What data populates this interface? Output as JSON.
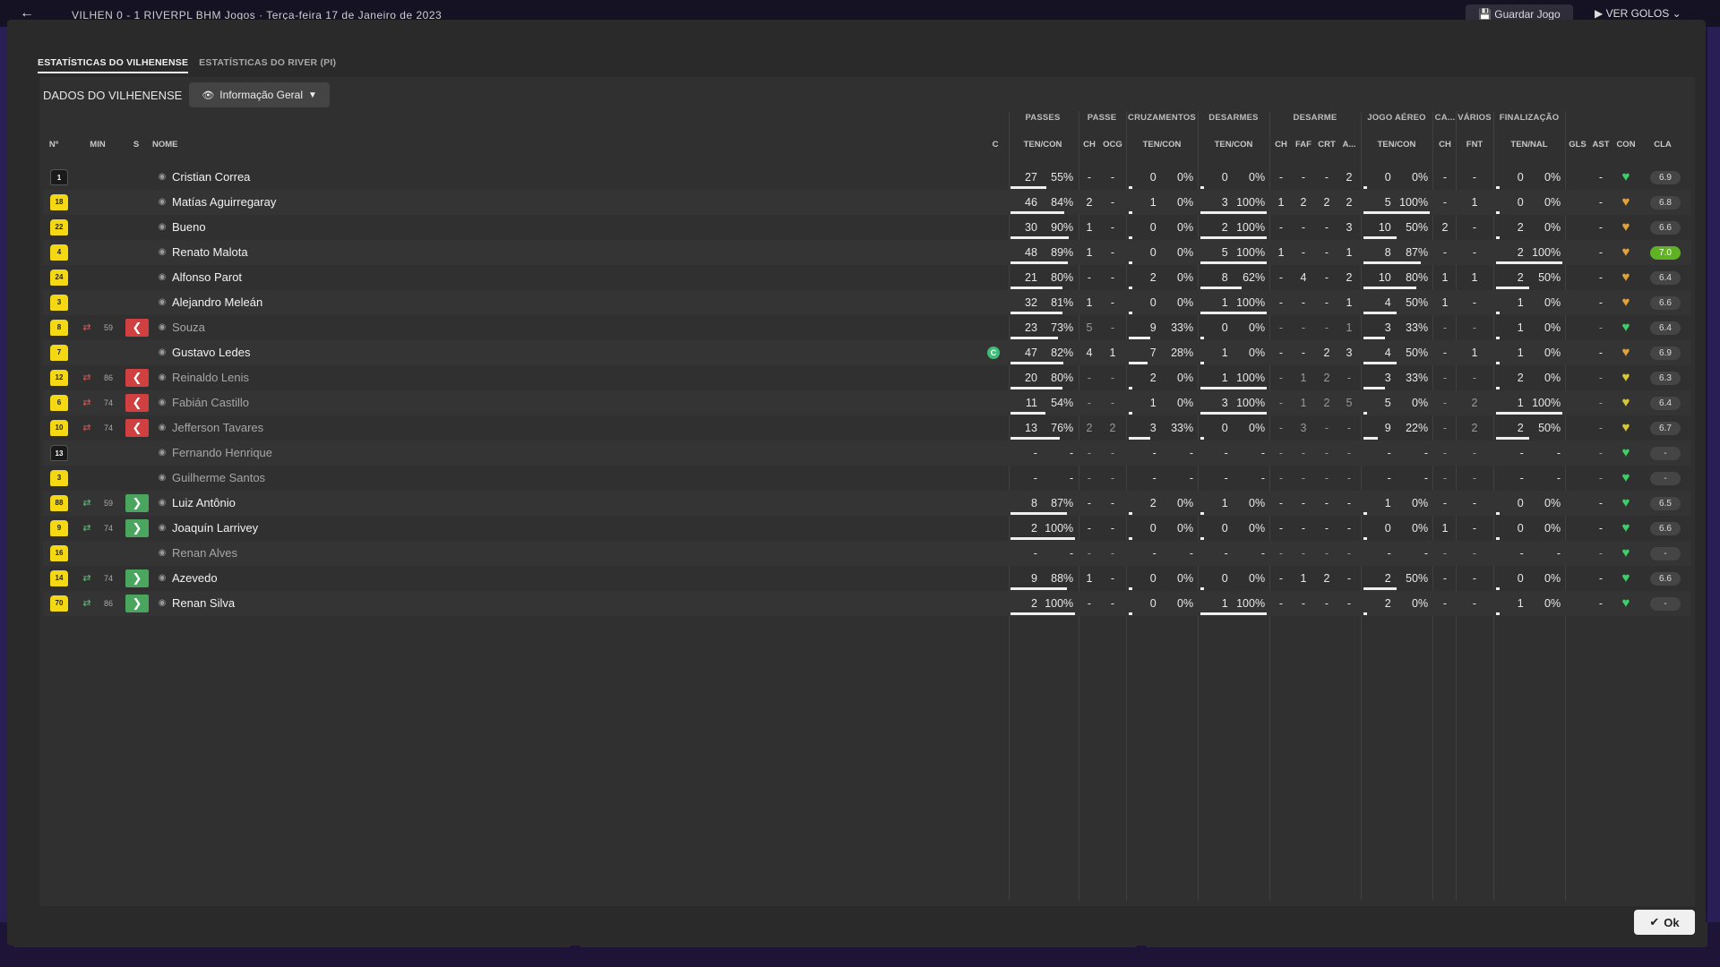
{
  "background": {
    "score_text": "VILHEN  0 - 1  RIVERPL  BHM  Jogos  ·  Terça-feira 17 de Janeiro de 2023",
    "save_label": "Guardar Jogo",
    "goals_label": "VER GOLOS"
  },
  "tabs": [
    {
      "label": "ESTATÍSTICAS DO VILHENENSE",
      "active": true
    },
    {
      "label": "ESTATÍSTICAS DO RIVER (PI)",
      "active": false
    }
  ],
  "panel": {
    "title": "DADOS DO VILHENENSE",
    "view_select": "Informação Geral"
  },
  "groups": [
    "PASSES",
    "PASSE",
    "CRUZAMENTOS",
    "DESARMES",
    "DESARME",
    "JOGO AÉREO",
    "CA...",
    "VÁRIOS",
    "FINALIZAÇÃO"
  ],
  "columns": {
    "no": "Nº",
    "min": "MIN",
    "s": "S",
    "name": "NOME",
    "c": "C",
    "passes": "TEN/CON",
    "pch": "CH",
    "pocg": "OCG",
    "cross": "TEN/CON",
    "tackles": "TEN/CON",
    "dch": "CH",
    "dfaf": "FAF",
    "dcrt": "CRT",
    "da": "A...",
    "aerial": "TEN/CON",
    "cach": "CH",
    "fnt": "FNT",
    "shots": "TEN/NAL",
    "gls": "GLS",
    "ast": "AST",
    "con": "CON",
    "cla": "CLA"
  },
  "players": [
    {
      "no": "1",
      "gk": true,
      "min": "",
      "sub": "",
      "name": "Cristian Correa",
      "dim": false,
      "cap": false,
      "p": [
        "27",
        "55%"
      ],
      "pch": "-",
      "pocg": "-",
      "cr": [
        "0",
        "0%"
      ],
      "ta": [
        "0",
        "0%"
      ],
      "dch": "-",
      "dfaf": "-",
      "dcrt": "-",
      "da": "2",
      "ae": [
        "0",
        "0%"
      ],
      "cach": "-",
      "fnt": "-",
      "sh": [
        "0",
        "0%"
      ],
      "gls": "",
      "ast": "-",
      "heart": "green",
      "rating": "6.9",
      "best": false
    },
    {
      "no": "18",
      "gk": false,
      "min": "",
      "sub": "",
      "name": "Matías Aguirregaray",
      "dim": false,
      "cap": false,
      "p": [
        "46",
        "84%"
      ],
      "pch": "2",
      "pocg": "-",
      "cr": [
        "1",
        "0%"
      ],
      "ta": [
        "3",
        "100%"
      ],
      "dch": "1",
      "dfaf": "2",
      "dcrt": "2",
      "da": "2",
      "ae": [
        "5",
        "100%"
      ],
      "cach": "-",
      "fnt": "1",
      "sh": [
        "0",
        "0%"
      ],
      "gls": "",
      "ast": "-",
      "heart": "orange",
      "rating": "6.8",
      "best": false
    },
    {
      "no": "22",
      "gk": false,
      "min": "",
      "sub": "",
      "name": "Bueno",
      "dim": false,
      "cap": false,
      "p": [
        "30",
        "90%"
      ],
      "pch": "1",
      "pocg": "-",
      "cr": [
        "0",
        "0%"
      ],
      "ta": [
        "2",
        "100%"
      ],
      "dch": "-",
      "dfaf": "-",
      "dcrt": "-",
      "da": "3",
      "ae": [
        "10",
        "50%"
      ],
      "cach": "2",
      "fnt": "-",
      "sh": [
        "2",
        "0%"
      ],
      "gls": "",
      "ast": "-",
      "heart": "orange",
      "rating": "6.6",
      "best": false
    },
    {
      "no": "4",
      "gk": false,
      "min": "",
      "sub": "",
      "name": "Renato Malota",
      "dim": false,
      "cap": false,
      "p": [
        "48",
        "89%"
      ],
      "pch": "1",
      "pocg": "-",
      "cr": [
        "0",
        "0%"
      ],
      "ta": [
        "5",
        "100%"
      ],
      "dch": "1",
      "dfaf": "-",
      "dcrt": "-",
      "da": "1",
      "ae": [
        "8",
        "87%"
      ],
      "cach": "-",
      "fnt": "-",
      "sh": [
        "2",
        "100%"
      ],
      "gls": "",
      "ast": "-",
      "heart": "orange",
      "rating": "7.0",
      "best": true
    },
    {
      "no": "24",
      "gk": false,
      "min": "",
      "sub": "",
      "name": "Alfonso Parot",
      "dim": false,
      "cap": false,
      "p": [
        "21",
        "80%"
      ],
      "pch": "-",
      "pocg": "-",
      "cr": [
        "2",
        "0%"
      ],
      "ta": [
        "8",
        "62%"
      ],
      "dch": "-",
      "dfaf": "4",
      "dcrt": "-",
      "da": "2",
      "ae": [
        "10",
        "80%"
      ],
      "cach": "1",
      "fnt": "1",
      "sh": [
        "2",
        "50%"
      ],
      "gls": "",
      "ast": "-",
      "heart": "orange",
      "rating": "6.4",
      "best": false
    },
    {
      "no": "3",
      "gk": false,
      "min": "",
      "sub": "",
      "name": "Alejandro Meleán",
      "dim": false,
      "cap": false,
      "p": [
        "32",
        "81%"
      ],
      "pch": "1",
      "pocg": "-",
      "cr": [
        "0",
        "0%"
      ],
      "ta": [
        "1",
        "100%"
      ],
      "dch": "-",
      "dfaf": "-",
      "dcrt": "-",
      "da": "1",
      "ae": [
        "4",
        "50%"
      ],
      "cach": "1",
      "fnt": "-",
      "sh": [
        "1",
        "0%"
      ],
      "gls": "",
      "ast": "-",
      "heart": "orange",
      "rating": "6.6",
      "best": false
    },
    {
      "no": "8",
      "gk": false,
      "min": "59",
      "sub": "out",
      "name": "Souza",
      "dim": true,
      "cap": false,
      "p": [
        "23",
        "73%"
      ],
      "pch": "5",
      "pocg": "-",
      "cr": [
        "9",
        "33%"
      ],
      "ta": [
        "0",
        "0%"
      ],
      "dch": "-",
      "dfaf": "-",
      "dcrt": "-",
      "da": "1",
      "ae": [
        "3",
        "33%"
      ],
      "cach": "-",
      "fnt": "-",
      "sh": [
        "1",
        "0%"
      ],
      "gls": "",
      "ast": "-",
      "heart": "green",
      "rating": "6.4",
      "best": false
    },
    {
      "no": "7",
      "gk": false,
      "min": "",
      "sub": "",
      "name": "Gustavo Ledes",
      "dim": false,
      "cap": true,
      "p": [
        "47",
        "82%"
      ],
      "pch": "4",
      "pocg": "1",
      "cr": [
        "7",
        "28%"
      ],
      "ta": [
        "1",
        "0%"
      ],
      "dch": "-",
      "dfaf": "-",
      "dcrt": "2",
      "da": "3",
      "ae": [
        "4",
        "50%"
      ],
      "cach": "-",
      "fnt": "1",
      "sh": [
        "1",
        "0%"
      ],
      "gls": "",
      "ast": "-",
      "heart": "orange",
      "rating": "6.9",
      "best": false
    },
    {
      "no": "12",
      "gk": false,
      "min": "86",
      "sub": "out",
      "name": "Reinaldo Lenis",
      "dim": true,
      "cap": false,
      "p": [
        "20",
        "80%"
      ],
      "pch": "-",
      "pocg": "-",
      "cr": [
        "2",
        "0%"
      ],
      "ta": [
        "1",
        "100%"
      ],
      "dch": "-",
      "dfaf": "1",
      "dcrt": "2",
      "da": "-",
      "ae": [
        "3",
        "33%"
      ],
      "cach": "-",
      "fnt": "-",
      "sh": [
        "2",
        "0%"
      ],
      "gls": "",
      "ast": "-",
      "heart": "yellow",
      "rating": "6.3",
      "best": false
    },
    {
      "no": "6",
      "gk": false,
      "min": "74",
      "sub": "out",
      "name": "Fabián Castillo",
      "dim": true,
      "cap": false,
      "p": [
        "11",
        "54%"
      ],
      "pch": "-",
      "pocg": "-",
      "cr": [
        "1",
        "0%"
      ],
      "ta": [
        "3",
        "100%"
      ],
      "dch": "-",
      "dfaf": "1",
      "dcrt": "2",
      "da": "5",
      "ae": [
        "5",
        "0%"
      ],
      "cach": "-",
      "fnt": "2",
      "sh": [
        "1",
        "100%"
      ],
      "gls": "",
      "ast": "-",
      "heart": "yellow",
      "rating": "6.4",
      "best": false
    },
    {
      "no": "10",
      "gk": false,
      "min": "74",
      "sub": "out",
      "name": "Jefferson Tavares",
      "dim": true,
      "cap": false,
      "p": [
        "13",
        "76%"
      ],
      "pch": "2",
      "pocg": "2",
      "cr": [
        "3",
        "33%"
      ],
      "ta": [
        "0",
        "0%"
      ],
      "dch": "-",
      "dfaf": "3",
      "dcrt": "-",
      "da": "-",
      "ae": [
        "9",
        "22%"
      ],
      "cach": "-",
      "fnt": "2",
      "sh": [
        "2",
        "50%"
      ],
      "gls": "",
      "ast": "-",
      "heart": "yellow",
      "rating": "6.7",
      "best": false
    },
    {
      "no": "13",
      "gk": true,
      "min": "",
      "sub": "",
      "name": "Fernando Henrique",
      "dim": true,
      "cap": false,
      "p": [
        "-",
        "-"
      ],
      "pch": "-",
      "pocg": "-",
      "cr": [
        "-",
        "-"
      ],
      "ta": [
        "-",
        "-"
      ],
      "dch": "-",
      "dfaf": "-",
      "dcrt": "-",
      "da": "-",
      "ae": [
        "-",
        "-"
      ],
      "cach": "-",
      "fnt": "-",
      "sh": [
        "-",
        "-"
      ],
      "gls": "",
      "ast": "-",
      "heart": "green",
      "rating": "-",
      "best": false
    },
    {
      "no": "3",
      "gk": false,
      "min": "",
      "sub": "",
      "name": "Guilherme Santos",
      "dim": true,
      "cap": false,
      "p": [
        "-",
        "-"
      ],
      "pch": "-",
      "pocg": "-",
      "cr": [
        "-",
        "-"
      ],
      "ta": [
        "-",
        "-"
      ],
      "dch": "-",
      "dfaf": "-",
      "dcrt": "-",
      "da": "-",
      "ae": [
        "-",
        "-"
      ],
      "cach": "-",
      "fnt": "-",
      "sh": [
        "-",
        "-"
      ],
      "gls": "",
      "ast": "-",
      "heart": "green",
      "rating": "-",
      "best": false
    },
    {
      "no": "88",
      "gk": false,
      "min": "59",
      "sub": "in",
      "name": "Luiz Antônio",
      "dim": false,
      "cap": false,
      "p": [
        "8",
        "87%"
      ],
      "pch": "-",
      "pocg": "-",
      "cr": [
        "2",
        "0%"
      ],
      "ta": [
        "1",
        "0%"
      ],
      "dch": "-",
      "dfaf": "-",
      "dcrt": "-",
      "da": "-",
      "ae": [
        "1",
        "0%"
      ],
      "cach": "-",
      "fnt": "-",
      "sh": [
        "0",
        "0%"
      ],
      "gls": "",
      "ast": "-",
      "heart": "green",
      "rating": "6.5",
      "best": false
    },
    {
      "no": "9",
      "gk": false,
      "min": "74",
      "sub": "in",
      "name": "Joaquín Larrivey",
      "dim": false,
      "cap": false,
      "p": [
        "2",
        "100%"
      ],
      "pch": "-",
      "pocg": "-",
      "cr": [
        "0",
        "0%"
      ],
      "ta": [
        "0",
        "0%"
      ],
      "dch": "-",
      "dfaf": "-",
      "dcrt": "-",
      "da": "-",
      "ae": [
        "0",
        "0%"
      ],
      "cach": "1",
      "fnt": "-",
      "sh": [
        "0",
        "0%"
      ],
      "gls": "",
      "ast": "-",
      "heart": "green",
      "rating": "6.6",
      "best": false
    },
    {
      "no": "16",
      "gk": false,
      "min": "",
      "sub": "",
      "name": "Renan Alves",
      "dim": true,
      "cap": false,
      "p": [
        "-",
        "-"
      ],
      "pch": "-",
      "pocg": "-",
      "cr": [
        "-",
        "-"
      ],
      "ta": [
        "-",
        "-"
      ],
      "dch": "-",
      "dfaf": "-",
      "dcrt": "-",
      "da": "-",
      "ae": [
        "-",
        "-"
      ],
      "cach": "-",
      "fnt": "-",
      "sh": [
        "-",
        "-"
      ],
      "gls": "",
      "ast": "-",
      "heart": "green",
      "rating": "-",
      "best": false
    },
    {
      "no": "14",
      "gk": false,
      "min": "74",
      "sub": "in",
      "name": "Azevedo",
      "dim": false,
      "cap": false,
      "p": [
        "9",
        "88%"
      ],
      "pch": "1",
      "pocg": "-",
      "cr": [
        "0",
        "0%"
      ],
      "ta": [
        "0",
        "0%"
      ],
      "dch": "-",
      "dfaf": "1",
      "dcrt": "2",
      "da": "-",
      "ae": [
        "2",
        "50%"
      ],
      "cach": "-",
      "fnt": "-",
      "sh": [
        "0",
        "0%"
      ],
      "gls": "",
      "ast": "-",
      "heart": "green",
      "rating": "6.6",
      "best": false
    },
    {
      "no": "70",
      "gk": false,
      "min": "86",
      "sub": "in",
      "name": "Renan Silva",
      "dim": false,
      "cap": false,
      "p": [
        "2",
        "100%"
      ],
      "pch": "-",
      "pocg": "-",
      "cr": [
        "0",
        "0%"
      ],
      "ta": [
        "1",
        "100%"
      ],
      "dch": "-",
      "dfaf": "-",
      "dcrt": "-",
      "da": "-",
      "ae": [
        "2",
        "0%"
      ],
      "cach": "-",
      "fnt": "-",
      "sh": [
        "1",
        "0%"
      ],
      "gls": "",
      "ast": "-",
      "heart": "green",
      "rating": "-",
      "best": false
    }
  ],
  "ok_label": "Ok",
  "colors": {
    "accent_green": "#5fb323",
    "sub_out": "#d04040",
    "sub_in": "#4aa55f",
    "shirt": "#f3d813"
  }
}
